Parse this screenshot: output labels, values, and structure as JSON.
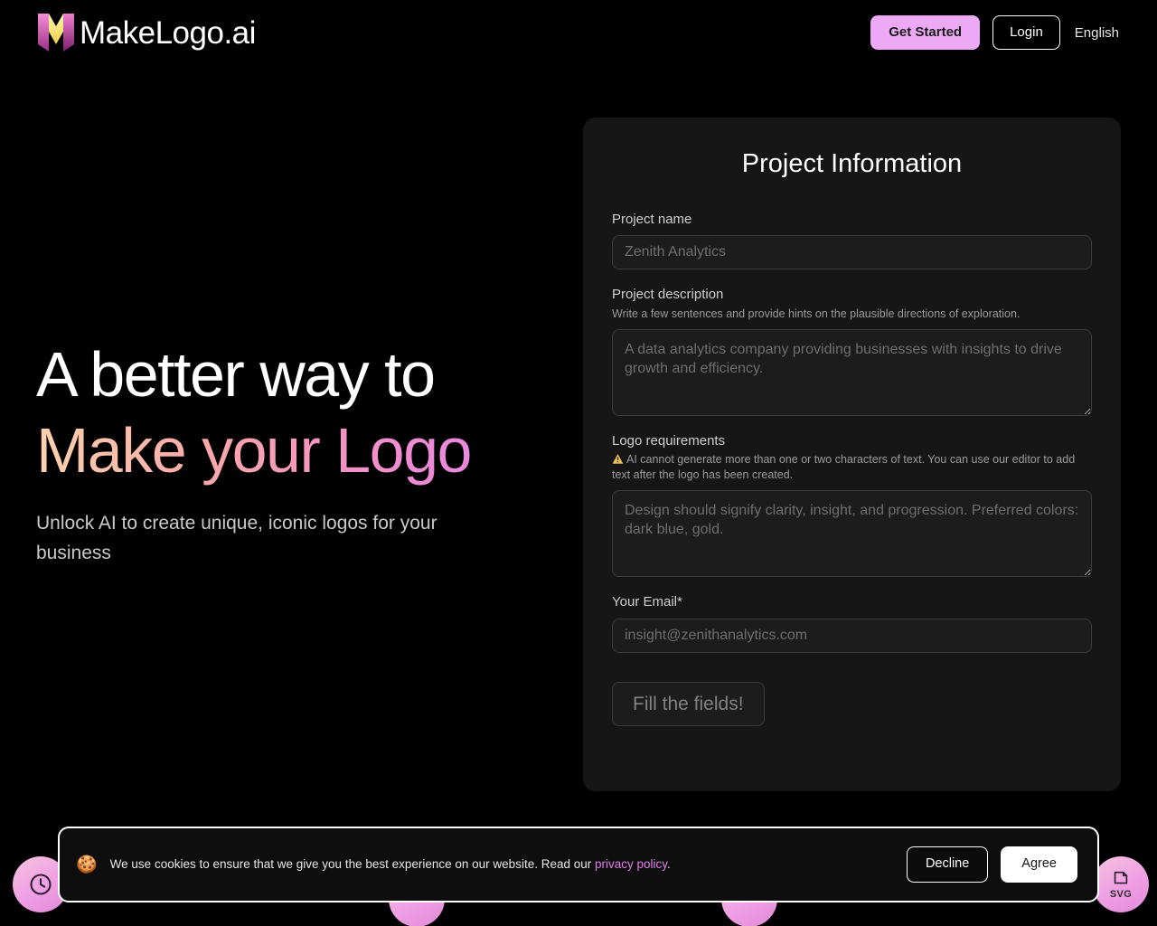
{
  "header": {
    "brand_name": "MakeLogo.ai",
    "logo_icon": "makelogo-m-mark-icon",
    "get_started_label": "Get Started",
    "login_label": "Login",
    "language_label": "English",
    "accent_color": "#eda9f5"
  },
  "hero": {
    "title_line1": "A better way to",
    "title_line2": "Make your Logo",
    "subtitle": "Unlock AI to create unique, iconic logos for your business",
    "gradient_from": "#fbd2ad",
    "gradient_mid": "#f491c6",
    "gradient_to": "#e17ff2"
  },
  "form": {
    "title": "Project Information",
    "project_name": {
      "label": "Project name",
      "value": "",
      "placeholder": "Zenith Analytics"
    },
    "project_description": {
      "label": "Project description",
      "hint": "Write a few sentences and provide hints on the plausible directions of exploration.",
      "value": "",
      "placeholder": "A data analytics company providing businesses with insights to drive growth and efficiency."
    },
    "logo_requirements": {
      "label": "Logo requirements",
      "warning_icon": "warning-triangle-icon",
      "hint": "AI cannot generate more than one or two characters of text. You can use our editor to add text after the logo has been created.",
      "value": "",
      "placeholder": "Design should signify clarity, insight, and progression. Preferred colors: dark blue, gold."
    },
    "email": {
      "label": "Your Email*",
      "value": "",
      "placeholder": "insight@zenithanalytics.com"
    },
    "submit_label": "Fill the fields!",
    "submit_disabled": true
  },
  "badges": [
    {
      "icon": "clock-icon",
      "label": ""
    },
    {
      "icon": "circle-icon",
      "label": ""
    },
    {
      "icon": "circle-icon",
      "label": ""
    },
    {
      "icon": "svg-file-icon",
      "label": "SVG"
    }
  ],
  "cookie_banner": {
    "icon": "cookie-icon",
    "message_before_link": "We use cookies to ensure that we give you the best experience on our website. Read our ",
    "link_text": "privacy policy",
    "message_after_link": ".",
    "decline_label": "Decline",
    "agree_label": "Agree",
    "link_color": "#e07fe8"
  }
}
